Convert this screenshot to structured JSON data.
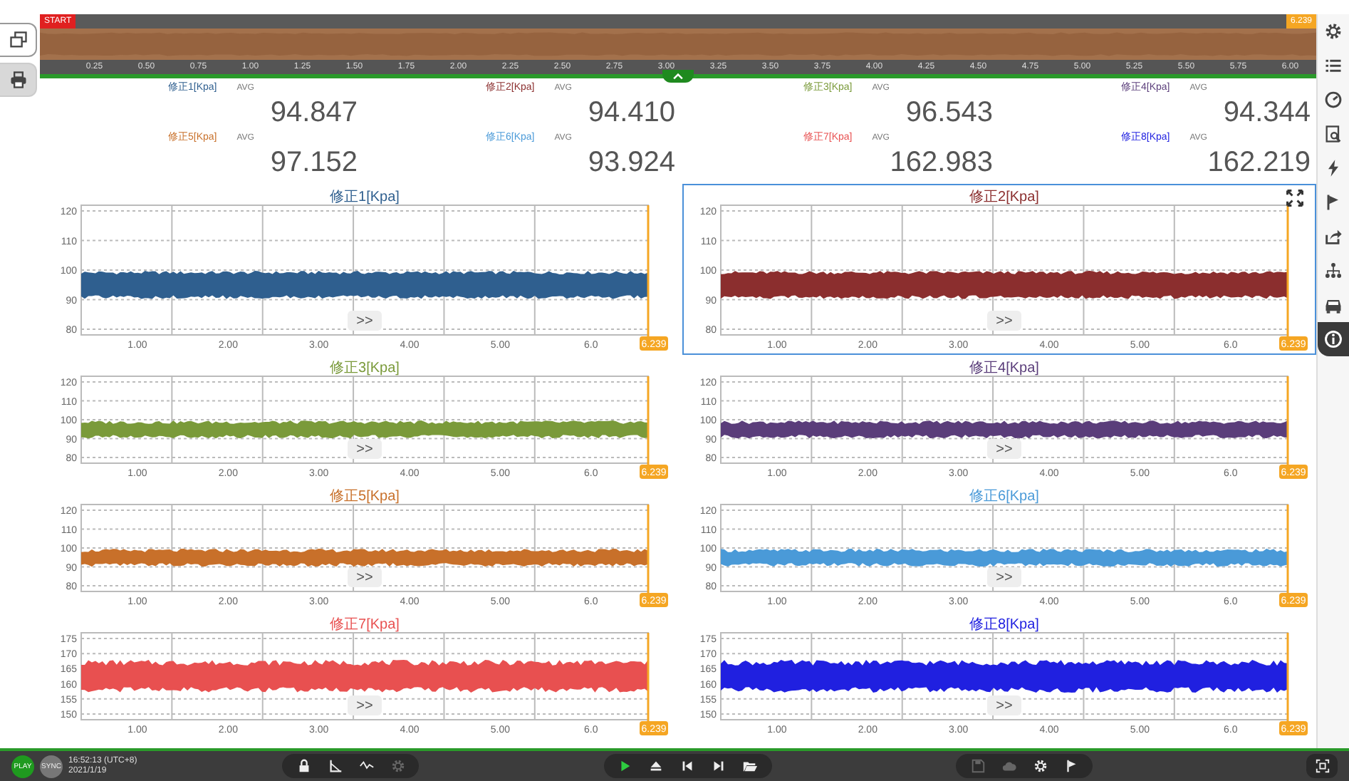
{
  "timeline": {
    "start_label": "START",
    "cursor_label": "6.239",
    "ticks": [
      "0.25",
      "0.50",
      "0.75",
      "1.00",
      "1.25",
      "1.50",
      "1.75",
      "2.00",
      "2.25",
      "2.50",
      "2.75",
      "3.00",
      "3.25",
      "3.50",
      "3.75",
      "4.00",
      "4.25",
      "4.50",
      "4.75",
      "5.00",
      "5.25",
      "5.50",
      "5.75",
      "6.00"
    ]
  },
  "left_tabs": [
    {
      "selected": true
    },
    {
      "selected": false
    }
  ],
  "sidebar": {
    "items": [
      {
        "selected": false
      },
      {
        "selected": false
      },
      {
        "selected": false
      },
      {
        "selected": false
      },
      {
        "selected": false
      },
      {
        "selected": false
      },
      {
        "selected": false
      },
      {
        "selected": false
      },
      {
        "selected": false
      },
      {
        "selected": true
      }
    ]
  },
  "readings": [
    {
      "label": "修正1[Kpa]",
      "stat": "AVG",
      "value": "94.847",
      "color": "#2f5f8f"
    },
    {
      "label": "修正2[Kpa]",
      "stat": "AVG",
      "value": "94.410",
      "color": "#8b2e2e"
    },
    {
      "label": "修正3[Kpa]",
      "stat": "AVG",
      "value": "96.543",
      "color": "#7a9a3a"
    },
    {
      "label": "修正4[Kpa]",
      "stat": "AVG",
      "value": "94.344",
      "color": "#5a3d7a"
    },
    {
      "label": "修正5[Kpa]",
      "stat": "AVG",
      "value": "97.152",
      "color": "#c8702a"
    },
    {
      "label": "修正6[Kpa]",
      "stat": "AVG",
      "value": "93.924",
      "color": "#4a9ad8"
    },
    {
      "label": "修正7[Kpa]",
      "stat": "AVG",
      "value": "162.983",
      "color": "#e85050"
    },
    {
      "label": "修正8[Kpa]",
      "stat": "AVG",
      "value": "162.219",
      "color": "#2020e0"
    }
  ],
  "charts": [
    {
      "title": "修正1[Kpa]",
      "color": "#2f5f8f",
      "selected": false,
      "yticks": [
        "120",
        "110",
        "100",
        "90",
        "80"
      ],
      "xticks": [
        "1.00",
        "2.00",
        "3.00",
        "4.00",
        "5.00",
        "6.0"
      ],
      "cursor_label": "6.239",
      "scroll_label": ">>"
    },
    {
      "title": "修正2[Kpa]",
      "color": "#8b2e2e",
      "selected": true,
      "yticks": [
        "120",
        "110",
        "100",
        "90",
        "80"
      ],
      "xticks": [
        "1.00",
        "2.00",
        "3.00",
        "4.00",
        "5.00",
        "6.0"
      ],
      "cursor_label": "6.239",
      "scroll_label": ">>"
    },
    {
      "title": "修正3[Kpa]",
      "color": "#7a9a3a",
      "selected": false,
      "yticks": [
        "120",
        "110",
        "100",
        "90",
        "80"
      ],
      "xticks": [
        "1.00",
        "2.00",
        "3.00",
        "4.00",
        "5.00",
        "6.0"
      ],
      "cursor_label": "6.239",
      "scroll_label": ">>"
    },
    {
      "title": "修正4[Kpa]",
      "color": "#5a3d7a",
      "selected": false,
      "yticks": [
        "120",
        "110",
        "100",
        "90",
        "80"
      ],
      "xticks": [
        "1.00",
        "2.00",
        "3.00",
        "4.00",
        "5.00",
        "6.0"
      ],
      "cursor_label": "6.239",
      "scroll_label": ">>"
    },
    {
      "title": "修正5[Kpa]",
      "color": "#c8702a",
      "selected": false,
      "yticks": [
        "120",
        "110",
        "100",
        "90",
        "80"
      ],
      "xticks": [
        "1.00",
        "2.00",
        "3.00",
        "4.00",
        "5.00",
        "6.0"
      ],
      "cursor_label": "6.239",
      "scroll_label": ">>"
    },
    {
      "title": "修正6[Kpa]",
      "color": "#4a9ad8",
      "selected": false,
      "yticks": [
        "120",
        "110",
        "100",
        "90",
        "80"
      ],
      "xticks": [
        "1.00",
        "2.00",
        "3.00",
        "4.00",
        "5.00",
        "6.0"
      ],
      "cursor_label": "6.239",
      "scroll_label": ">>"
    },
    {
      "title": "修正7[Kpa]",
      "color": "#e85050",
      "selected": false,
      "yticks": [
        "175",
        "170",
        "165",
        "160",
        "155",
        "150"
      ],
      "xticks": [
        "1.00",
        "2.00",
        "3.00",
        "4.00",
        "5.00",
        "6.0"
      ],
      "cursor_label": "6.239",
      "scroll_label": ">>"
    },
    {
      "title": "修正8[Kpa]",
      "color": "#2020e0",
      "selected": false,
      "yticks": [
        "175",
        "170",
        "165",
        "160",
        "155",
        "150"
      ],
      "xticks": [
        "1.00",
        "2.00",
        "3.00",
        "4.00",
        "5.00",
        "6.0"
      ],
      "cursor_label": "6.239",
      "scroll_label": ">>"
    }
  ],
  "bottom_bar": {
    "play_label": "PLAY",
    "sync_label": "SYNC",
    "time": "16:52:13 (UTC+8)",
    "date": "2021/1/19",
    "groups": [
      {
        "buttons": [
          {
            "disabled": false
          },
          {
            "disabled": false
          },
          {
            "disabled": false
          },
          {
            "disabled": true
          }
        ]
      },
      {
        "buttons": [
          {
            "disabled": false
          },
          {
            "disabled": false
          },
          {
            "disabled": false
          },
          {
            "disabled": false
          },
          {
            "disabled": false
          }
        ]
      },
      {
        "buttons": [
          {
            "disabled": true
          },
          {
            "disabled": true
          },
          {
            "disabled": false
          },
          {
            "disabled": false
          }
        ]
      }
    ]
  }
}
